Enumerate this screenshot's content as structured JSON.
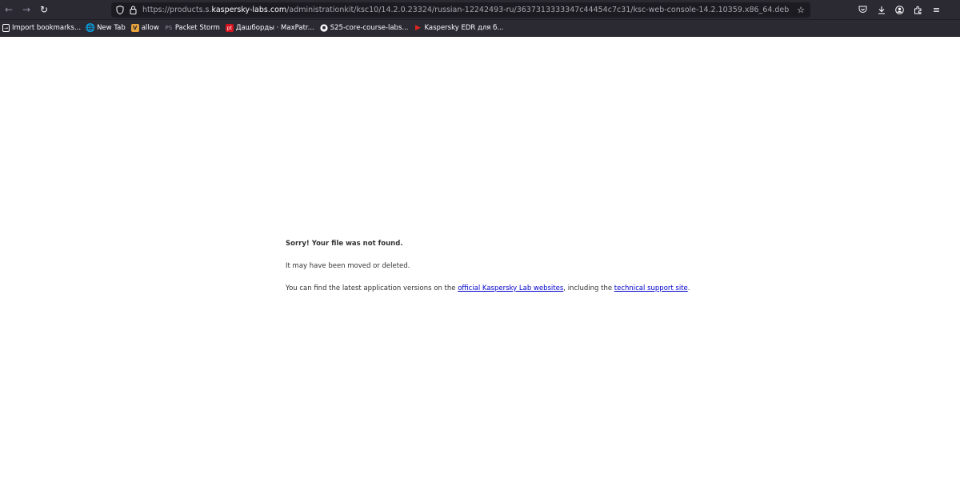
{
  "browser": {
    "url_prefix": "https://products.s.",
    "url_domain": "kaspersky-labs.com",
    "url_suffix": "/administrationkit/ksc10/14.2.0.23324/russian-12242493-ru/3637313333347c44454c7c31/ksc-web-console-14.2.10359.x86_64.deb"
  },
  "bookmarks": [
    {
      "label": "Import bookmarks...",
      "icon": "import-icon"
    },
    {
      "label": "New Tab",
      "icon": "globe-icon"
    },
    {
      "label": "allow",
      "icon": "allow-favicon"
    },
    {
      "label": "Packet Storm",
      "icon": "packetstorm-favicon"
    },
    {
      "label": "Дашборды · MaxPatr...",
      "icon": "pt-favicon"
    },
    {
      "label": "S25-core-course-labs...",
      "icon": "github-icon"
    },
    {
      "label": "Kaspersky EDR для б...",
      "icon": "play-icon"
    }
  ],
  "page": {
    "title": "Sorry! Your file was not found.",
    "line2": "It may have been moved or deleted.",
    "line3_pre": "You can find the latest application versions on the ",
    "link1": "official Kaspersky Lab websites",
    "line3_mid": ", including the ",
    "link2": "technical support site",
    "line3_post": "."
  },
  "colors": {
    "link": "#0000cc",
    "toolbar": "#2b2a33",
    "urlbar": "#1c1b22"
  }
}
